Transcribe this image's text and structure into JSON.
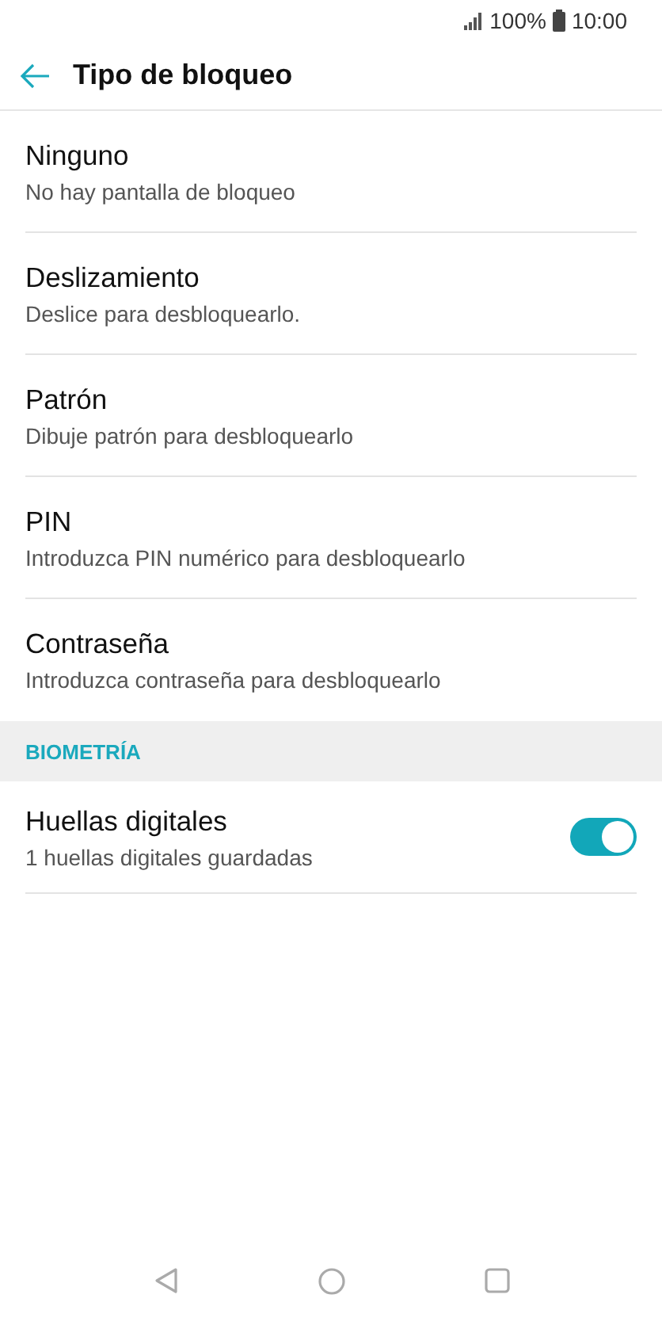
{
  "status_bar": {
    "battery": "100%",
    "time": "10:00"
  },
  "app_bar": {
    "title": "Tipo de bloqueo"
  },
  "lock_options": [
    {
      "title": "Ninguno",
      "subtitle": "No hay pantalla de bloqueo"
    },
    {
      "title": "Deslizamiento",
      "subtitle": "Deslice para desbloquearlo."
    },
    {
      "title": "Patrón",
      "subtitle": "Dibuje patrón para desbloquearlo"
    },
    {
      "title": "PIN",
      "subtitle": "Introduzca PIN numérico para desbloquearlo"
    },
    {
      "title": "Contraseña",
      "subtitle": "Introduzca contraseña para desbloquearlo"
    }
  ],
  "biometrics": {
    "header": "BIOMETRÍA",
    "items": [
      {
        "title": "Huellas digitales",
        "subtitle": "1 huellas digitales guardadas",
        "on": true
      }
    ]
  }
}
